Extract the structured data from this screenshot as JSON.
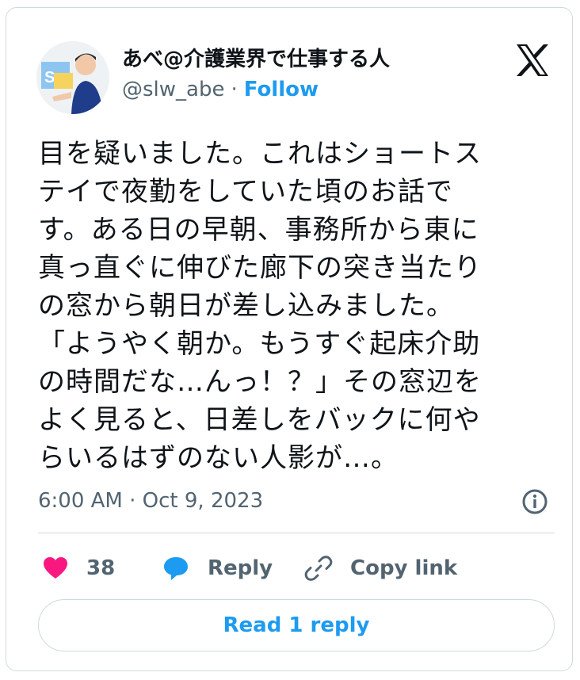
{
  "author": {
    "display_name": "あべ@介護業界で仕事する人",
    "handle": "@slw_abe",
    "separator": "·",
    "follow_label": "Follow"
  },
  "tweet": {
    "lines": [
      "目を疑いました。これはショートス",
      "テイで夜勤をしていた頃のお話で",
      "す。ある日の早朝、事務所から東に",
      "真っ直ぐに伸びた廊下の突き当たり",
      "の窓から朝日が差し込みました。",
      "「ようやく朝か。もうすぐ起床介助",
      "の時間だな…んっ！？」その窓辺を",
      "よく見ると、日差しをバックに何や",
      "らいるはずのない人影が…。"
    ],
    "timestamp": "6:00 AM · Oct 9, 2023"
  },
  "actions": {
    "like_count": "38",
    "reply_label": "Reply",
    "copy_label": "Copy link"
  },
  "read_reply_label": "Read 1 reply",
  "colors": {
    "accent": "#1d9bf0",
    "like": "#f91880",
    "muted": "#536471",
    "border": "#cfd9de"
  },
  "icons": [
    "avatar",
    "x-logo-icon",
    "info-icon",
    "heart-icon",
    "reply-bubble-icon",
    "link-icon"
  ]
}
